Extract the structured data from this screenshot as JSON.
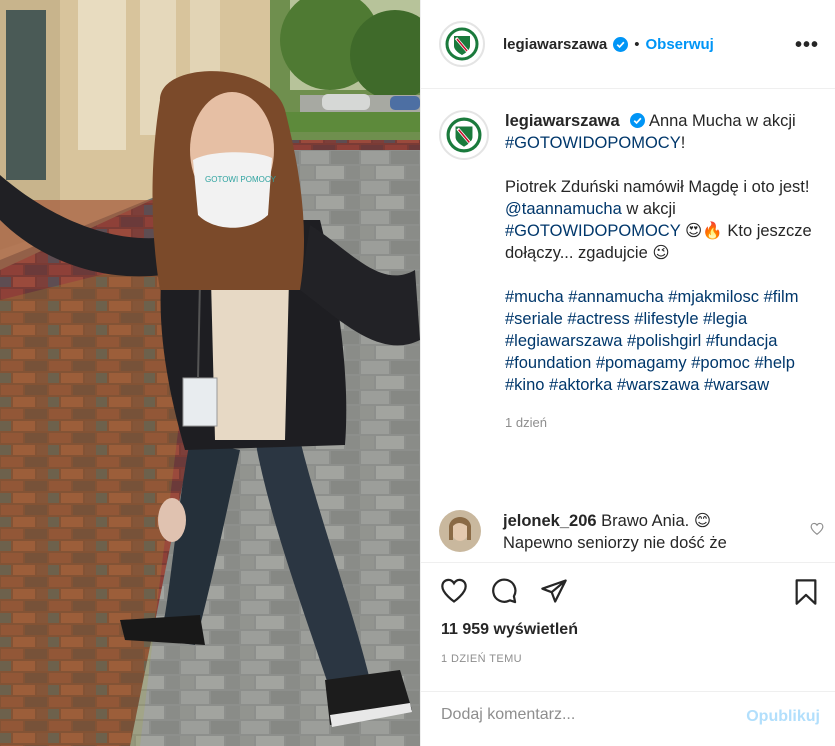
{
  "post": {
    "account": "legiawarszawa",
    "follow_label": "Obserwuj",
    "dot": "•",
    "more_label": "•••",
    "caption": {
      "username": "legiawarszawa",
      "line1_a": "Anna Mucha w akcji",
      "line1_tag": "#GOTOWIDOPOMOCY",
      "line1_end": "!",
      "para2_a": "Piotrek Zduński namówił Magdę i oto jest!",
      "mention": "@taannamucha",
      "para3_a": "w akcji",
      "para3_tag": "#GOTOWIDOPOMOCY",
      "para3_emoji": "😍🔥",
      "para3_b": "Kto jeszcze dołączy... zgadujcie",
      "para3_emoji2": "😉",
      "hashtags": "#mucha #annamucha #mjakmilosc #film #seriale #actress #lifestyle #legia #legiawarszawa #polishgirl #fundacja #foundation #pomagamy #pomoc #help #kino #aktorka #warszawa #warsaw"
    },
    "caption_time": "1 dzień",
    "comment": {
      "username": "jelonek_206",
      "text_a": "Brawo Ania.",
      "emoji": "😊",
      "text_b": "Napewno seniorzy nie dość że"
    },
    "views": "11 959 wyświetleń",
    "time_ago": "1 DZIEŃ TEMU",
    "comment_placeholder": "Dodaj komentarz...",
    "publish_label": "Opublikuj"
  },
  "colors": {
    "accent": "#0095f6",
    "tag": "#00376b",
    "muted": "#8e8e8e",
    "publish_disabled": "#b2dffc",
    "legia_green": "#1a7a3c",
    "legia_red": "#c8102e"
  },
  "icons": [
    "verified-badge-icon",
    "heart-icon",
    "comment-icon",
    "share-icon",
    "bookmark-icon",
    "more-options-icon",
    "small-heart-icon"
  ]
}
